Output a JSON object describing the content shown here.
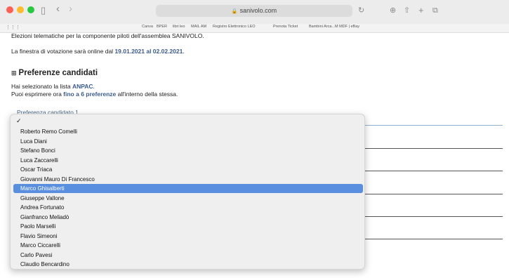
{
  "browser": {
    "url": "sanivolo.com",
    "favorites": [
      "Canva",
      "BPER",
      "libri leo",
      "MAIL AM",
      "Registro Elettronico LEO",
      "Prenota Ticket",
      "Bambini Arca...M MDF | eBay"
    ]
  },
  "page": {
    "intro": "Elezioni telematiche per la componente piloti dell'assemblea SANIVOLO.",
    "window_prefix": "La finestra di votazione sarà online dal ",
    "window_dates": "19.01.2021 al 02.02.2021",
    "window_suffix": ".",
    "section_title": "Preferenze candidati",
    "list_prefix": "Hai selezionato la lista ",
    "list_name": "ANPAC",
    "list_suffix": ".",
    "pref_prefix": "Puoi esprimere ora ",
    "pref_highlight": "fino a 6 preferenze",
    "pref_suffix": " all'interno della stessa.",
    "field_label": "Preferenza candidato 1"
  },
  "dropdown": {
    "check": "✓",
    "options": [
      "Roberto Remo Comelli",
      "Luca Diani",
      "Stefano Bonci",
      "Luca Zaccarelli",
      "Oscar Triaca",
      "Giovanni Mauro Di Francesco",
      "Marco Ghisalberti",
      "Giuseppe Vallone",
      "Andrea Fortunato",
      "Gianfranco Meliadò",
      "Paolo Marselli",
      "Flavio Simeoni",
      "Marco Ciccarelli",
      "Carlo Pavesi",
      "Claudio Bencardino"
    ],
    "selected": "Marco Ghisalberti"
  }
}
